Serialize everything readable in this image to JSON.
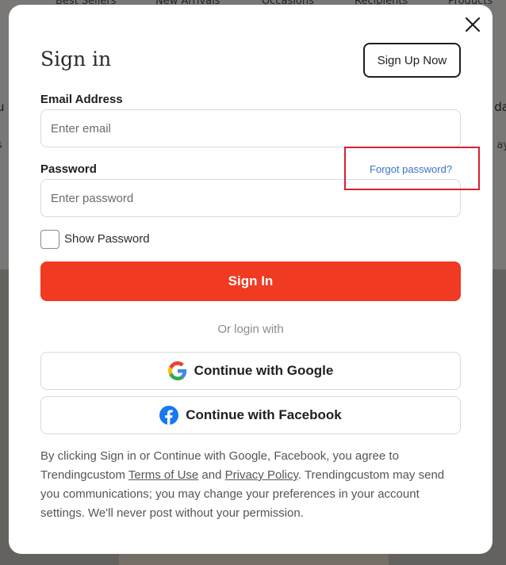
{
  "background": {
    "nav_items": [
      "Best Sellers",
      "New Arrivals",
      "Occasions",
      "Recipients",
      "Products"
    ],
    "side_left": "u",
    "side_left_sub": "s",
    "side_right": "da",
    "side_right_sub": "ay"
  },
  "modal": {
    "title": "Sign in",
    "signup_label": "Sign Up Now",
    "email": {
      "label": "Email Address",
      "placeholder": "Enter email",
      "value": ""
    },
    "password": {
      "label": "Password",
      "placeholder": "Enter password",
      "value": "",
      "forgot_label": "Forgot password?"
    },
    "show_password_label": "Show Password",
    "show_password_checked": false,
    "signin_label": "Sign In",
    "or_label": "Or login with",
    "google_label": "Continue with Google",
    "facebook_label": "Continue with Facebook",
    "legal": {
      "part1": "By clicking Sign in or Continue with Google, Facebook, you agree to Trendingcustom ",
      "terms": "Terms of Use",
      "and": " and ",
      "privacy": "Privacy Policy",
      "part2": ". Trendingcustom may send you communications; you may change your preferences in your account settings. We'll never post without your permission."
    }
  },
  "colors": {
    "accent": "#f03a22",
    "link": "#3b73c7",
    "highlight": "#d9202d",
    "facebook": "#1877f2"
  },
  "icons": {
    "close": "close-icon",
    "google": "google-logo-icon",
    "facebook": "facebook-logo-icon"
  }
}
